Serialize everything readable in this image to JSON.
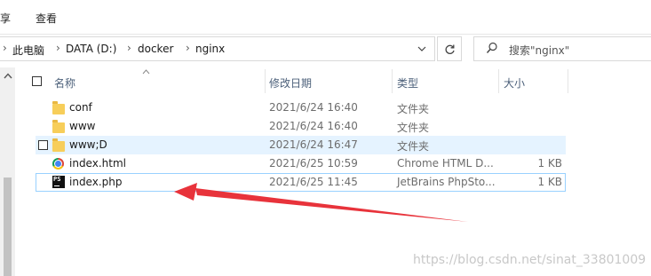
{
  "ribbon": {
    "tabs": [
      "享",
      "查看"
    ]
  },
  "breadcrumb": {
    "items": [
      "此电脑",
      "DATA (D:)",
      "docker",
      "nginx"
    ]
  },
  "search": {
    "placeholder": "搜索\"nginx\""
  },
  "columns": {
    "name": "名称",
    "date": "修改日期",
    "type": "类型",
    "size": "大小"
  },
  "files": [
    {
      "name": "conf",
      "date": "2021/6/24 16:40",
      "type": "文件夹",
      "size": "",
      "icon": "folder-icon"
    },
    {
      "name": "www",
      "date": "2021/6/24 16:40",
      "type": "文件夹",
      "size": "",
      "icon": "folder-icon"
    },
    {
      "name": "www;D",
      "date": "2021/6/24 16:47",
      "type": "文件夹",
      "size": "",
      "icon": "folder-icon"
    },
    {
      "name": "index.html",
      "date": "2021/6/25 10:59",
      "type": "Chrome HTML D...",
      "size": "1 KB",
      "icon": "chrome-icon"
    },
    {
      "name": "index.php",
      "date": "2021/6/25 11:45",
      "type": "JetBrains PhpSto...",
      "size": "1 KB",
      "icon": "phpstorm-icon"
    }
  ],
  "annotation": {
    "arrow_color": "#e8333b",
    "points_to": "index.php"
  },
  "watermark": "https://blog.csdn.net/sinat_33801009"
}
